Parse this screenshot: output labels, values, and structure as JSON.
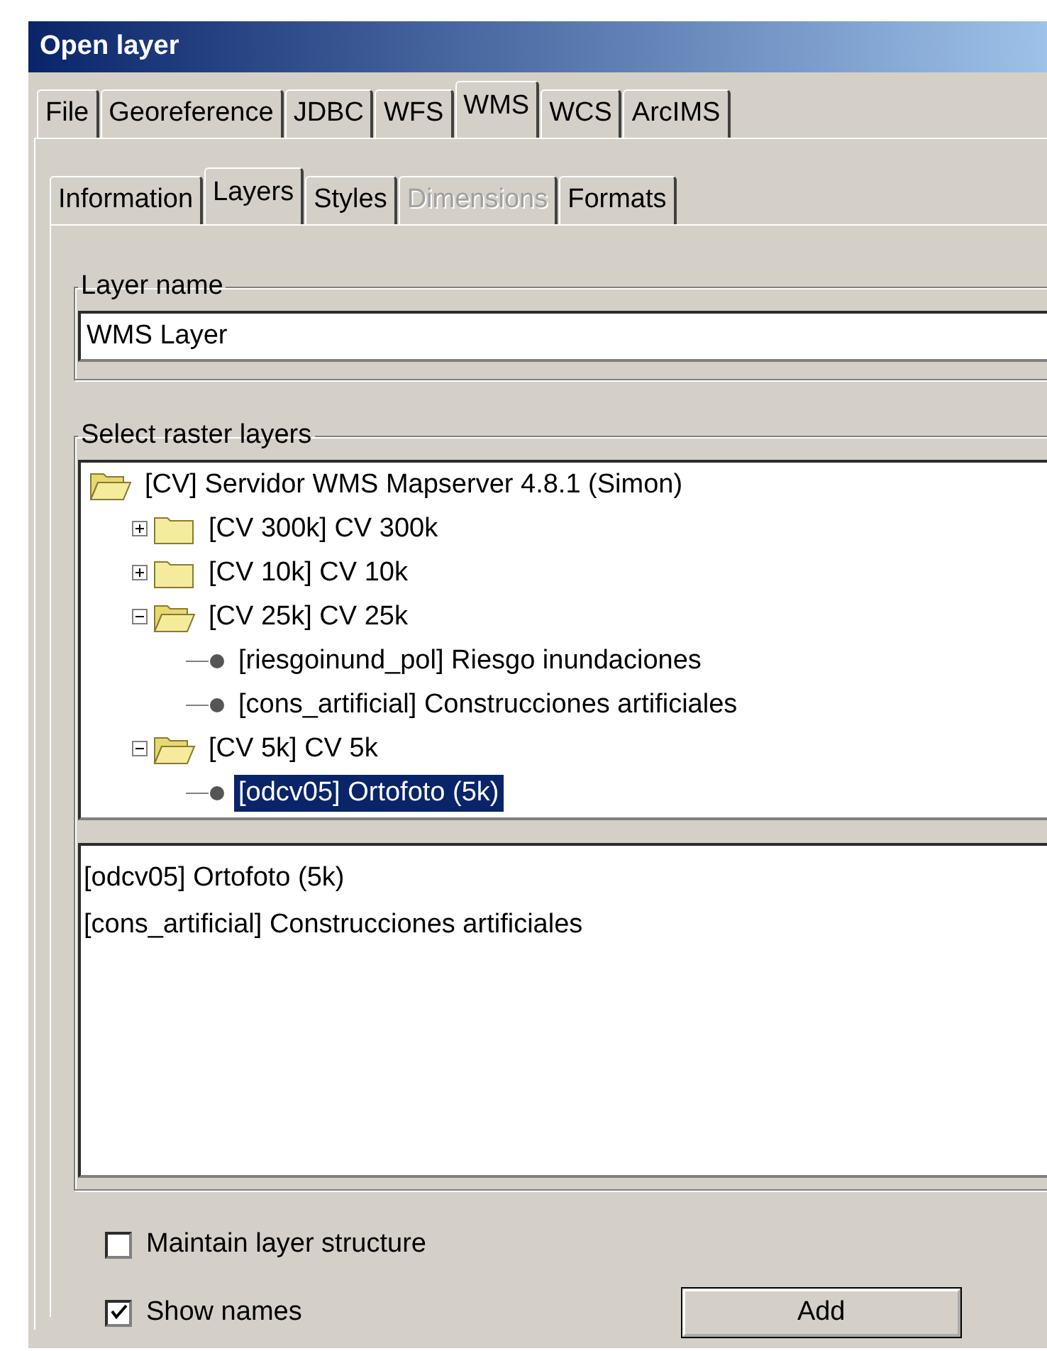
{
  "window": {
    "title": "Open layer"
  },
  "tabs": [
    {
      "label": "File",
      "selected": false
    },
    {
      "label": "Georeference",
      "selected": false
    },
    {
      "label": "JDBC",
      "selected": false
    },
    {
      "label": "WFS",
      "selected": false
    },
    {
      "label": "WMS",
      "selected": true
    },
    {
      "label": "WCS",
      "selected": false
    },
    {
      "label": "ArcIMS",
      "selected": false
    }
  ],
  "subtabs": [
    {
      "label": "Information",
      "selected": false,
      "disabled": false
    },
    {
      "label": "Layers",
      "selected": true,
      "disabled": false
    },
    {
      "label": "Styles",
      "selected": false,
      "disabled": false
    },
    {
      "label": "Dimensions",
      "selected": false,
      "disabled": true
    },
    {
      "label": "Formats",
      "selected": false,
      "disabled": false
    }
  ],
  "layer_name": {
    "legend": "Layer name",
    "value": "WMS Layer"
  },
  "raster_layers": {
    "legend": "Select raster layers",
    "tree": {
      "label": "[CV] Servidor WMS Mapserver 4.8.1 (Simon)",
      "kind": "folder",
      "expanded": true,
      "selected": false,
      "children": [
        {
          "label": "[CV 300k] CV 300k",
          "kind": "folder",
          "expanded": false,
          "selected": false
        },
        {
          "label": "[CV 10k] CV 10k",
          "kind": "folder",
          "expanded": false,
          "selected": false
        },
        {
          "label": "[CV 25k] CV 25k",
          "kind": "folder",
          "expanded": true,
          "selected": false,
          "children": [
            {
              "label": "[riesgoinund_pol] Riesgo inundaciones",
              "kind": "layer",
              "selected": false
            },
            {
              "label": "[cons_artificial] Construcciones artificiales",
              "kind": "layer",
              "selected": false
            }
          ]
        },
        {
          "label": "[CV 5k] CV 5k",
          "kind": "folder",
          "expanded": true,
          "selected": false,
          "children": [
            {
              "label": "[odcv05] Ortofoto (5k)",
              "kind": "layer",
              "selected": true
            }
          ]
        }
      ]
    },
    "selected_list": [
      "[odcv05] Ortofoto (5k)",
      "[cons_artificial] Construcciones artificiales"
    ]
  },
  "options": [
    {
      "label": "Maintain layer structure",
      "checked": false
    },
    {
      "label": "Show names",
      "checked": true
    }
  ],
  "buttons": [
    "Add"
  ]
}
